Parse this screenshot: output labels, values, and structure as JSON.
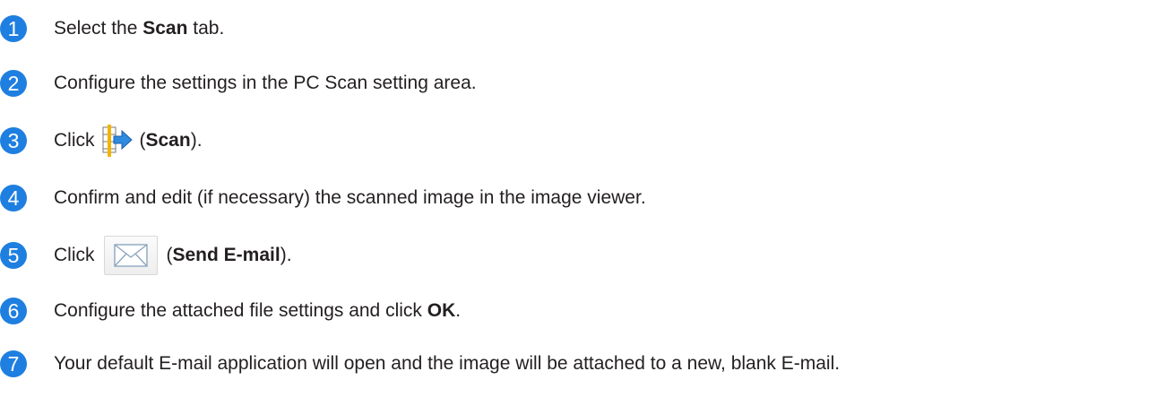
{
  "steps": [
    {
      "number": "1",
      "text_before": "Select the ",
      "bold": "Scan",
      "text_after": " tab."
    },
    {
      "number": "2",
      "text": "Configure the settings in the PC Scan setting area."
    },
    {
      "number": "3",
      "text_before": "Click",
      "icon": "scan-icon",
      "text_open": "(",
      "bold": "Scan",
      "text_after": ")."
    },
    {
      "number": "4",
      "text": "Confirm and edit (if necessary) the scanned image in the image viewer."
    },
    {
      "number": "5",
      "text_before": "Click",
      "icon": "send-email-icon",
      "text_open": "(",
      "bold": "Send E-mail",
      "text_after": ")."
    },
    {
      "number": "6",
      "text_before": "Configure the attached file settings and click ",
      "bold": "OK",
      "text_after": "."
    },
    {
      "number": "7",
      "text": "Your default E-mail application will open and the image will be attached to a new, blank E-mail."
    }
  ],
  "colors": {
    "step_badge": "#1f7fe0",
    "text": "#231f20"
  }
}
